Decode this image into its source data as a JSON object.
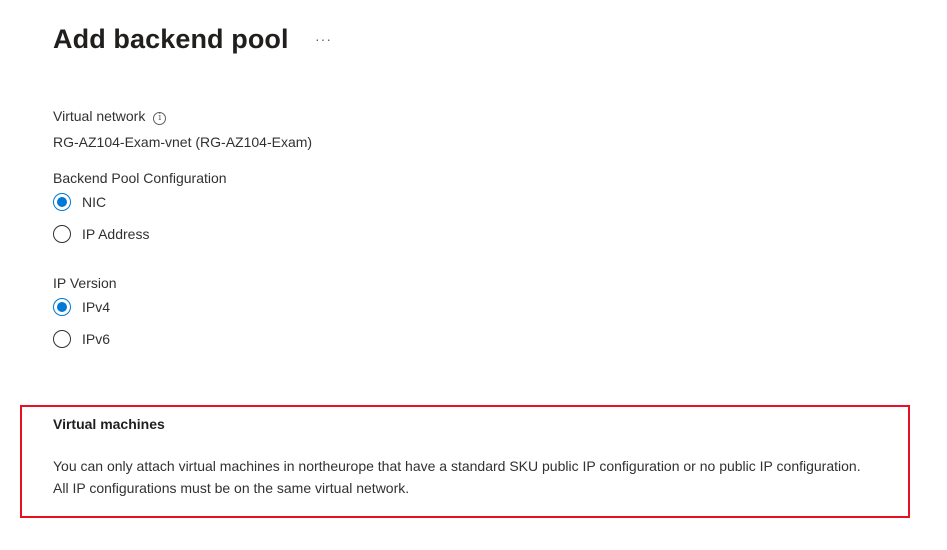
{
  "header": {
    "title": "Add backend pool",
    "more_label": "···"
  },
  "virtual_network": {
    "label": "Virtual network",
    "info_icon": "i",
    "value": "RG-AZ104-Exam-vnet (RG-AZ104-Exam)"
  },
  "backend_pool_config": {
    "label": "Backend Pool Configuration",
    "options": [
      {
        "label": "NIC",
        "checked": true
      },
      {
        "label": "IP Address",
        "checked": false
      }
    ]
  },
  "ip_version": {
    "label": "IP Version",
    "options": [
      {
        "label": "IPv4",
        "checked": true
      },
      {
        "label": "IPv6",
        "checked": false
      }
    ]
  },
  "virtual_machines": {
    "title": "Virtual machines",
    "description": "You can only attach virtual machines in northeurope that have a standard SKU public IP configuration or no public IP configuration. All IP configurations must be on the same virtual network.",
    "highlight_color": "#e81123"
  },
  "colors": {
    "accent": "#0078d4",
    "text": "#323130"
  }
}
